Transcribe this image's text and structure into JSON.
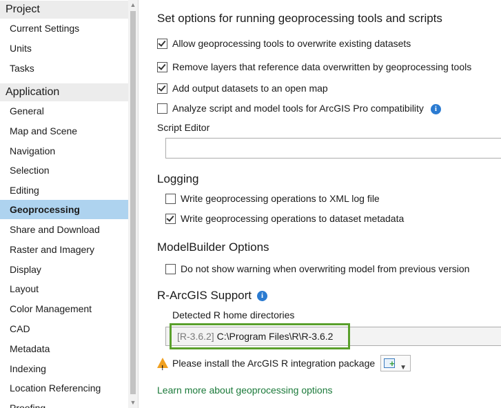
{
  "sidebar": {
    "project_header": "Project",
    "project_items": [
      "Current Settings",
      "Units",
      "Tasks"
    ],
    "application_header": "Application",
    "application_items": [
      "General",
      "Map and Scene",
      "Navigation",
      "Selection",
      "Editing",
      "Geoprocessing",
      "Share and Download",
      "Raster and Imagery",
      "Display",
      "Layout",
      "Color Management",
      "CAD",
      "Metadata",
      "Indexing",
      "Location Referencing",
      "Proofing"
    ],
    "selected_item": "Geoprocessing"
  },
  "main": {
    "section_title": "Set options for running geoprocessing tools and scripts",
    "options": [
      {
        "label": "Allow geoprocessing tools to overwrite existing datasets",
        "checked": true
      },
      {
        "label": "Remove layers that reference data overwritten by geoprocessing tools",
        "checked": true
      },
      {
        "label": "Add output datasets to an open map",
        "checked": true
      },
      {
        "label": "Analyze script and model tools for ArcGIS Pro compatibility",
        "checked": false
      }
    ],
    "script_editor_label": "Script Editor",
    "script_editor_value": "",
    "logging_title": "Logging",
    "logging_options": [
      {
        "label": "Write geoprocessing operations to XML log file",
        "checked": false
      },
      {
        "label": "Write geoprocessing operations to dataset metadata",
        "checked": true
      }
    ],
    "modelbuilder_title": "ModelBuilder Options",
    "modelbuilder_options": [
      {
        "label": "Do not show warning when overwriting model from previous version",
        "checked": false
      }
    ],
    "r_title": "R-ArcGIS Support",
    "r_home_label": "Detected R home directories",
    "r_home_version": "[R-3.6.2]",
    "r_home_path": "C:\\Program Files\\R\\R-3.6.2",
    "warning_text": "Please install the ArcGIS R integration package",
    "learn_more_link": "Learn more about geoprocessing options"
  },
  "colors": {
    "selected_bg": "#aed3ef",
    "info_icon": "#2b7bd1",
    "highlight_border": "#5aa02c",
    "link": "#1b7a3a",
    "warning_icon": "#f0a020"
  },
  "icons": [
    "info-icon",
    "warning-icon",
    "package-install-icon",
    "chevron-down-icon",
    "scroll-up-icon",
    "scroll-down-icon"
  ]
}
